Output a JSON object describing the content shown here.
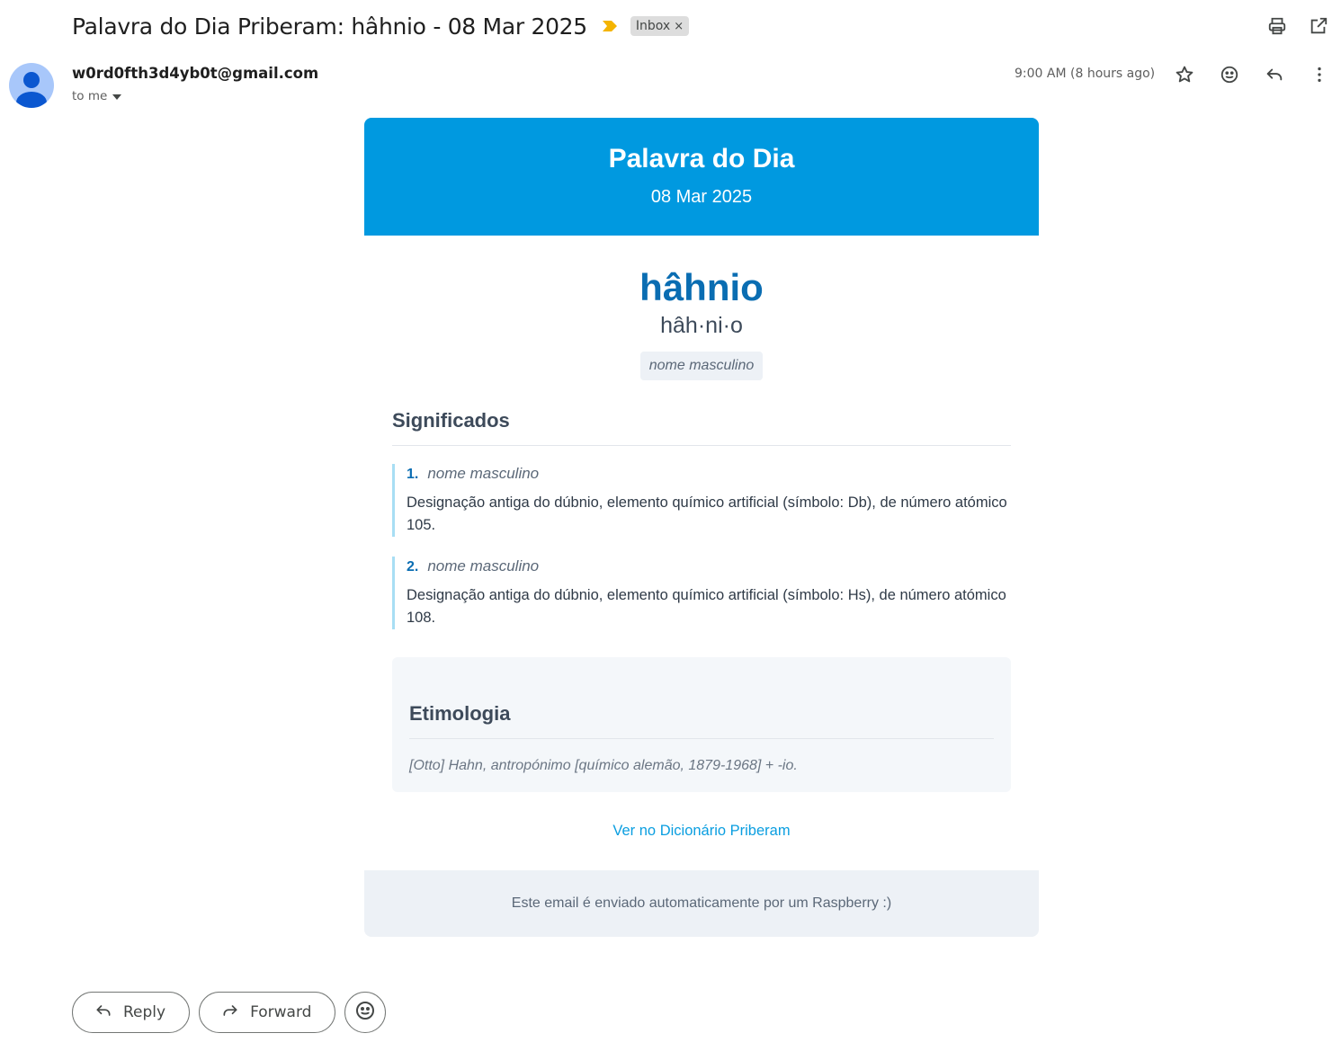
{
  "email": {
    "subject": "Palavra do Dia Priberam: hâhnio - 08 Mar 2025",
    "label": "Inbox",
    "label_remove": "×",
    "sender": "w0rd0fth3d4yb0t@gmail.com",
    "recipient": "to me",
    "time": "9:00 AM (8 hours ago)"
  },
  "icons": {
    "importance": "importance-marker-icon",
    "print": "print-icon",
    "open_new": "open-in-new-window-icon",
    "star": "star-icon",
    "emoji": "emoji-reaction-icon",
    "reply": "reply-icon",
    "more": "more-vertical-icon",
    "dropdown": "dropdown-arrow-icon",
    "forward": "forward-icon"
  },
  "body": {
    "banner_title": "Palavra do Dia",
    "banner_date": "08 Mar 2025",
    "word": "hâhnio",
    "syllables": "hâh·ni·o",
    "part_of_speech": "nome masculino",
    "meanings_title": "Significados",
    "meanings": [
      {
        "num": "1.",
        "pos": "nome masculino",
        "text": "Designação antiga do dúbnio, elemento químico artificial (símbolo: Db), de número atómico 105."
      },
      {
        "num": "2.",
        "pos": "nome masculino",
        "text": "Designação antiga do dúbnio, elemento químico artificial (símbolo: Hs), de número atómico 108."
      }
    ],
    "etymology_title": "Etimologia",
    "etymology_text": "[Otto] Hahn, antropónimo [químico alemão, 1879-1968] + -io.",
    "link_text": "Ver no Dicionário Priberam",
    "footer_text": "Este email é enviado automaticamente por um Raspberry :)"
  },
  "actions": {
    "reply": "Reply",
    "forward": "Forward"
  },
  "colors": {
    "banner": "#0099e0",
    "word": "#0a6db2",
    "link": "#0a9ee0",
    "importance": "#f4b400"
  }
}
